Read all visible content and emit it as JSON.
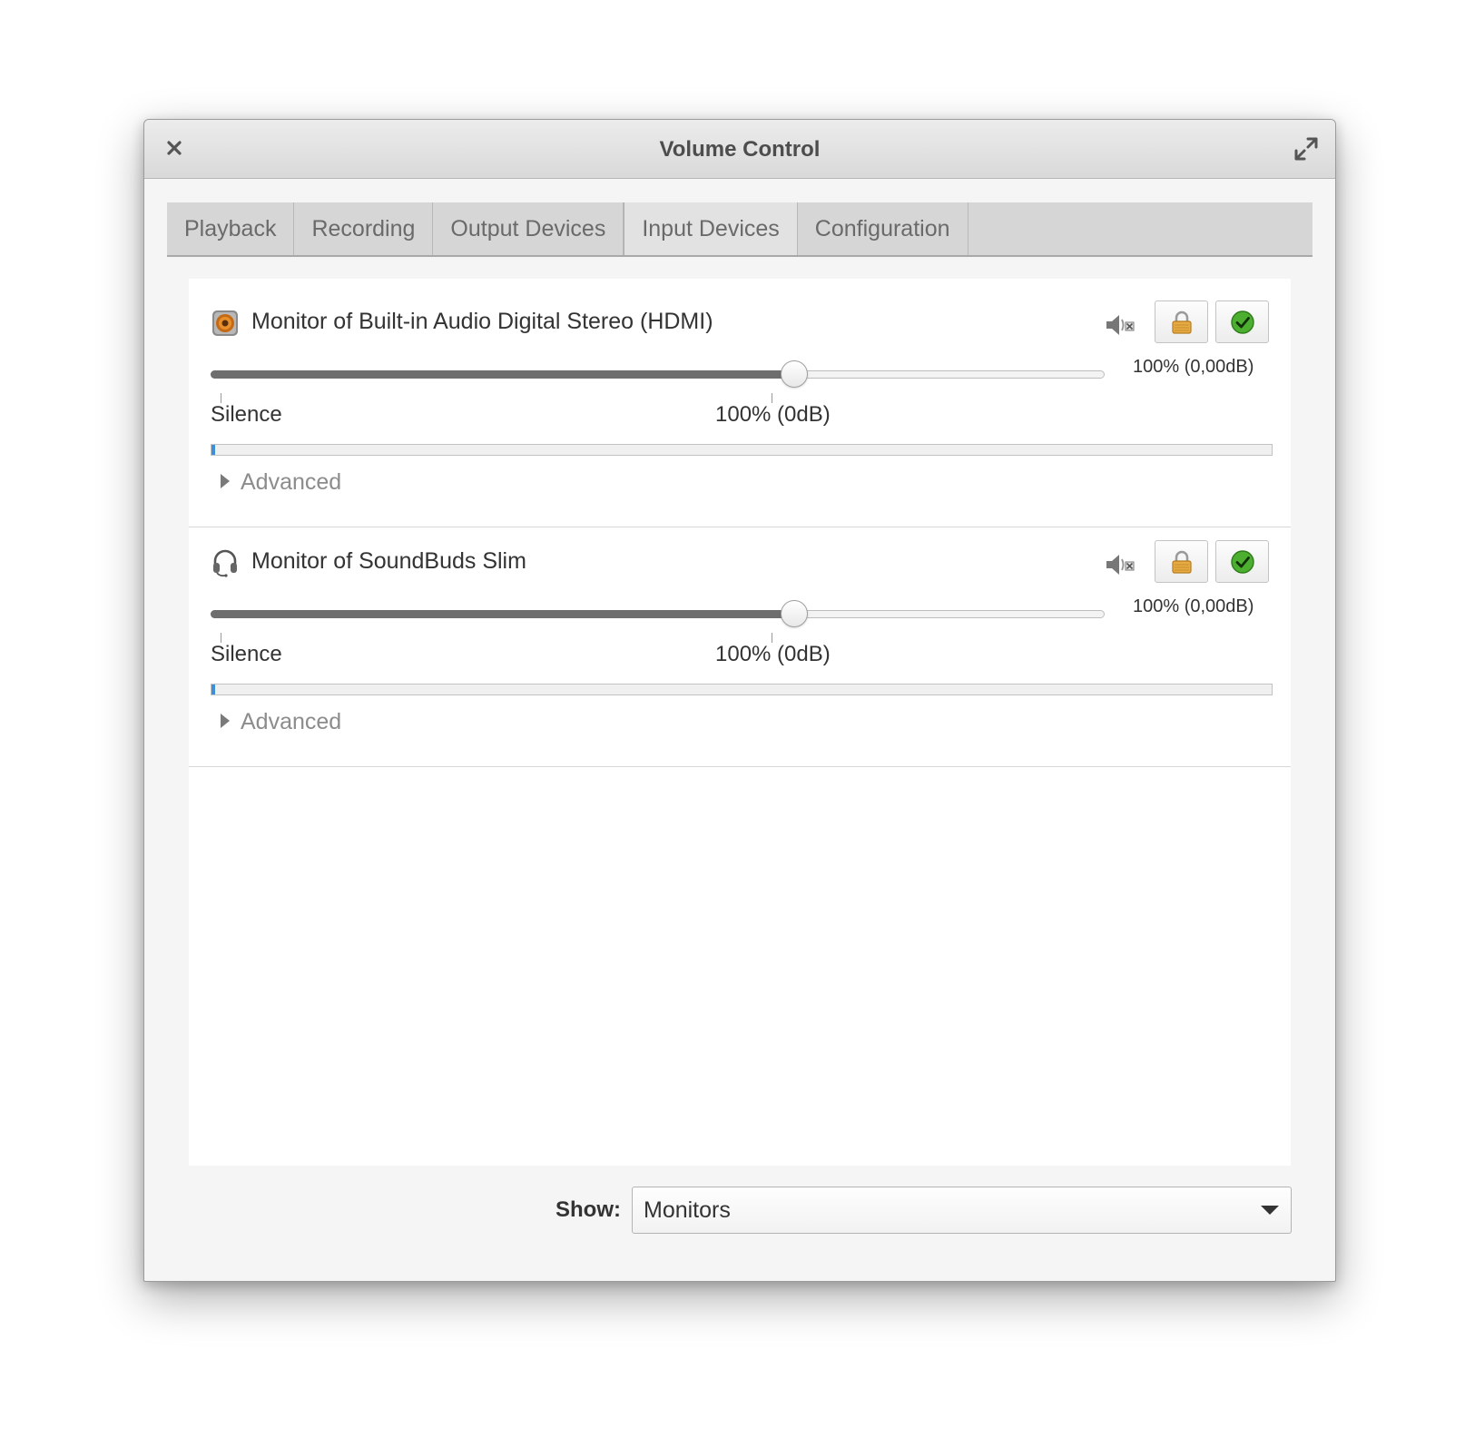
{
  "window": {
    "title": "Volume Control"
  },
  "tabs": [
    {
      "label": "Playback",
      "active": false
    },
    {
      "label": "Recording",
      "active": false
    },
    {
      "label": "Output Devices",
      "active": false
    },
    {
      "label": "Input Devices",
      "active": true
    },
    {
      "label": "Configuration",
      "active": false
    }
  ],
  "devices": [
    {
      "name": "Monitor of Built-in Audio Digital Stereo (HDMI)",
      "icon": "speaker-icon",
      "volume_readout": "100% (0,00dB)",
      "volume_fraction": 0.653,
      "mark_silence": "Silence",
      "mark_100": "100% (0dB)",
      "level_fraction": 0.003,
      "advanced_label": "Advanced",
      "lock_channels": true,
      "is_default": true
    },
    {
      "name": "Monitor of SoundBuds Slim",
      "icon": "headset-icon",
      "volume_readout": "100% (0,00dB)",
      "volume_fraction": 0.653,
      "mark_silence": "Silence",
      "mark_100": "100% (0dB)",
      "level_fraction": 0.003,
      "advanced_label": "Advanced",
      "lock_channels": true,
      "is_default": true
    }
  ],
  "footer": {
    "show_label": "Show:",
    "show_value": "Monitors"
  },
  "colors": {
    "level_meter": "#3d8fd8",
    "slider_fill": "#6e6e6e",
    "default_check": "#4caf30",
    "lock": "#d9a13a"
  }
}
